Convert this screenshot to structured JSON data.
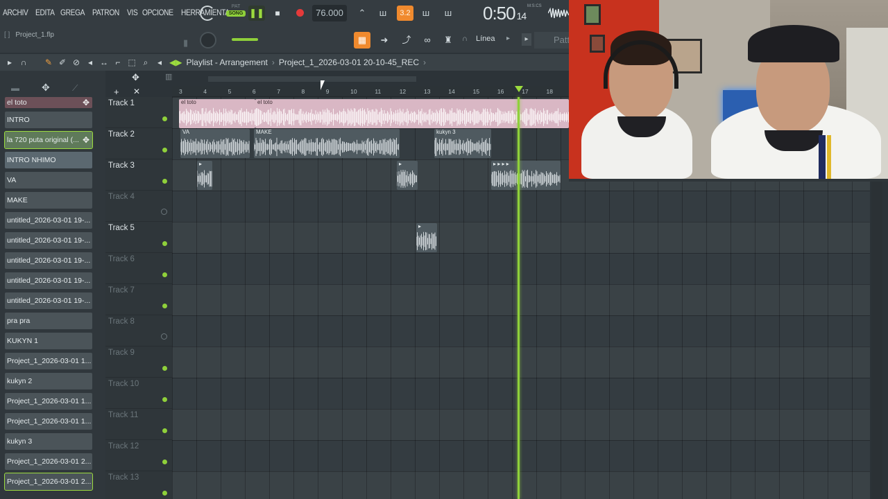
{
  "menu": [
    "ARCHIV",
    "EDITA",
    "GREGA",
    "PATRON",
    "VIS",
    "OPCIONE",
    "HERRAMIENTA"
  ],
  "transport": {
    "pat_label": "PAT",
    "song_label": "SONG",
    "tempo": "76.000",
    "time_main": "0:50",
    "time_sub": "14",
    "time_unit": "M:S:CS",
    "tool_32_label": "3.2"
  },
  "hint": {
    "bracket": "[ ]",
    "project_file": "Project_1.flp"
  },
  "snap": {
    "label": "Línea",
    "pattern_button": "Patt"
  },
  "playlist": {
    "title": "Playlist - Arrangement",
    "project_name": "Project_1_2026-03-01 20-10-45_REC"
  },
  "ruler_ticks": [
    "3",
    "4",
    "5",
    "6",
    "7",
    "8",
    "9",
    "10",
    "11",
    "12",
    "13",
    "14",
    "15",
    "16",
    "17",
    "18"
  ],
  "clip_list": [
    "el toto",
    "INTRO",
    "la 720 puta original (...",
    "INTRO NHIMO",
    "VA",
    "MAKE",
    "untitled_2026-03-01 19-...",
    "untitled_2026-03-01 19-...",
    "untitled_2026-03-01 19-...",
    "untitled_2026-03-01 19-...",
    "untitled_2026-03-01 19-...",
    "pra pra",
    "KUKYN 1",
    "Project_1_2026-03-01 1...",
    "kukyn 2",
    "Project_1_2026-03-01 1...",
    "Project_1_2026-03-01 1...",
    "kukyn 3",
    "Project_1_2026-03-01 2...",
    "Project_1_2026-03-01 2..."
  ],
  "tracks": [
    "Track 1",
    "Track 2",
    "Track 3",
    "Track 4",
    "Track 5",
    "Track 6",
    "Track 7",
    "Track 8",
    "Track 9",
    "Track 10",
    "Track 11",
    "Track 12",
    "Track 13"
  ],
  "clips": {
    "t1a": "el toto",
    "t1b": "el toto",
    "t2a": "VA",
    "t2b": "MAKE",
    "t2c": "kukyn 3"
  }
}
